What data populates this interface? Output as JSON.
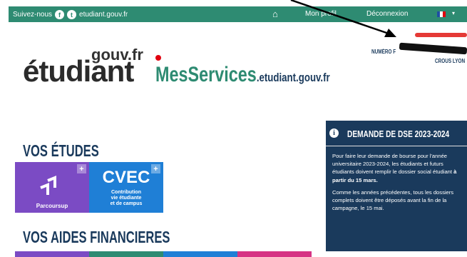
{
  "topbar": {
    "follow_label": "Suivez-nous",
    "facebook_glyph": "f",
    "twitter_glyph": "t",
    "site": "etudiant.gouv.fr",
    "home_glyph": "⌂",
    "profile": "Mon profil",
    "logout": "Déconnexion",
    "lang_caret": "▾",
    "flag_colors": [
      "#1f4fa3",
      "#ffffff",
      "#e1000f"
    ]
  },
  "logo": {
    "gouv": "gouv.fr",
    "etudiant": "étudiant",
    "messervices": "MesServices",
    "domain": ".etudiant.gouv.fr"
  },
  "user": {
    "numero_label": "NUMÉRO F",
    "crous": "CROUS LYON"
  },
  "sections": {
    "etudes": "VOS ÉTUDES",
    "aides": "VOS AIDES FINANCIERES"
  },
  "tiles": {
    "parcoursup": {
      "label": "Parcoursup",
      "color": "#7b4bc4",
      "icon": "parcoursup-arrows-icon"
    },
    "cvec": {
      "title": "CVEC",
      "sub1": "Contribution",
      "sub2": "vie étudiante",
      "sub3": "et de campus",
      "color": "#1f7fd6"
    },
    "plus_glyph": "+"
  },
  "panel": {
    "info_glyph": "i",
    "title": "DEMANDE DE DSE 2023-2024",
    "p1_text": "Pour faire leur demande de bourse pour l'année universitaire 2023-2024, les étudiants et futurs étudiants doivent remplir le dossier social étudiant ",
    "p1_bold": "à partir du 15 mars.",
    "p2": "Comme les années précédentes, tous les dossiers complets doivent être déposés avant la fin de la campagne, le 15 mai."
  },
  "colors": {
    "green": "#2e8b72",
    "navy": "#1a3a5c",
    "strips": [
      "#7b4bc4",
      "#2e8b72",
      "#1f7fd6",
      "#d63384"
    ]
  }
}
